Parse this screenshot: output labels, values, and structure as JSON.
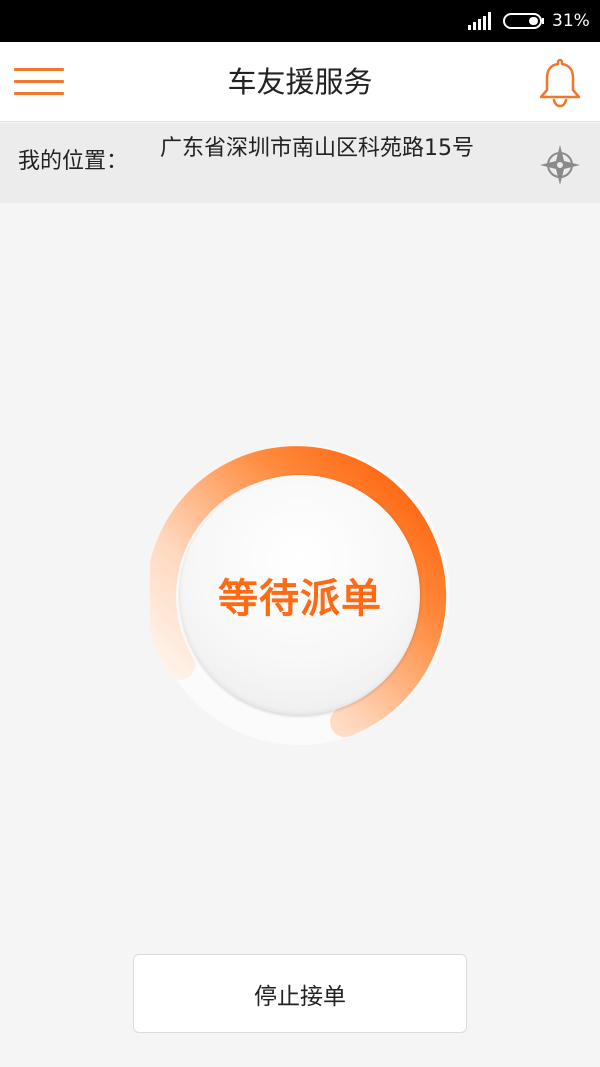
{
  "status_bar": {
    "battery_percent": "31%",
    "icons": [
      "signal-icon",
      "battery-icon"
    ]
  },
  "header": {
    "title": "车友援服务",
    "left_icon": "menu-icon",
    "right_icon": "bell-icon"
  },
  "location": {
    "label": "我的位置：",
    "address": "广东省深圳市南山区科苑路15号",
    "icon": "locate-icon"
  },
  "status_ring": {
    "label": "等待派单"
  },
  "stop_button": {
    "label": "停止接单"
  },
  "colors": {
    "accent": "#ff6a13",
    "accent_light": "#f0772c",
    "background": "#f5f5f5",
    "location_bar": "#ececec"
  }
}
